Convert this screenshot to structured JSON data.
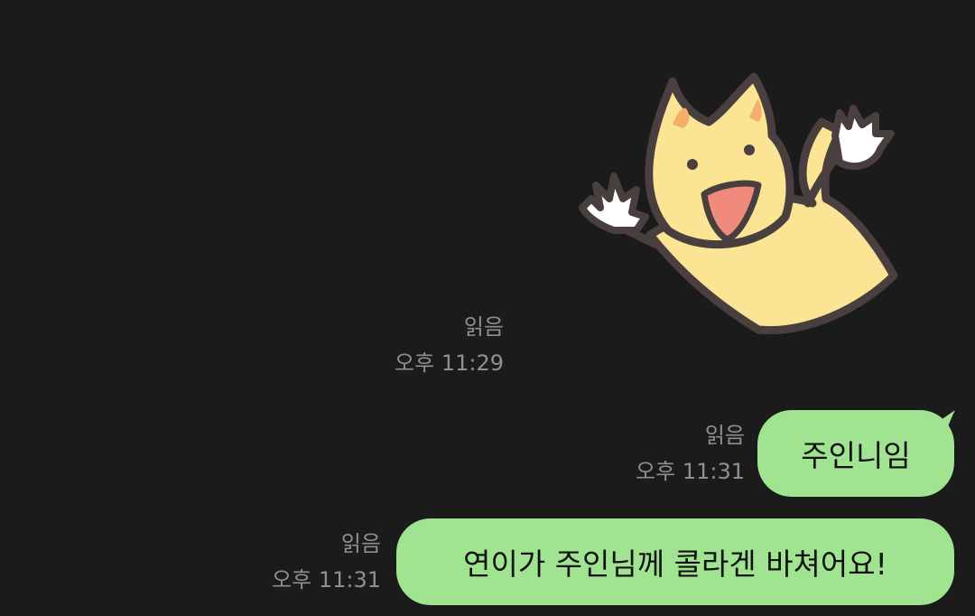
{
  "messages": [
    {
      "type": "sticker",
      "sticker_icon": "waving-yellow-cat-sticker",
      "read_label": "읽음",
      "time": "오후 11:29"
    },
    {
      "type": "text",
      "text": "주인니임",
      "read_label": "읽음",
      "time": "오후 11:31"
    },
    {
      "type": "text",
      "text": "연이가 주인님께 콜라겐 바쳐어요!",
      "read_label": "읽음",
      "time": "오후 11:31"
    }
  ],
  "colors": {
    "background": "#1b1b1b",
    "bubble": "#a0e391",
    "meta_text": "#8f8f8f",
    "sticker_fill": "#fbe493",
    "sticker_outline": "#4a3f3f",
    "sticker_mouth": "#f08a7d"
  }
}
